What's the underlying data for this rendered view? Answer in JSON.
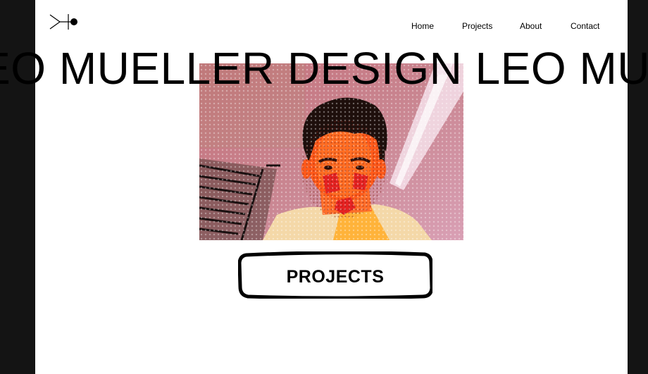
{
  "header": {
    "logo_icon": "arrow-line-dot-logo-icon",
    "nav": {
      "home": "Home",
      "projects": "Projects",
      "about": "About",
      "contact": "Contact"
    }
  },
  "hero": {
    "marquee_text": "LEO MUELLER DESIGN LEO MUELLER DESIGN LEO MUELLER DESIGN",
    "photo_subject": "halftone-portrait-photo"
  },
  "cta": {
    "label": "PROJECTS"
  },
  "colors": {
    "page_bg": "#ffffff",
    "outer_bg": "#141414",
    "text": "#000000",
    "photo_pink": "#c97a82",
    "photo_orange": "#ff5a1a"
  }
}
